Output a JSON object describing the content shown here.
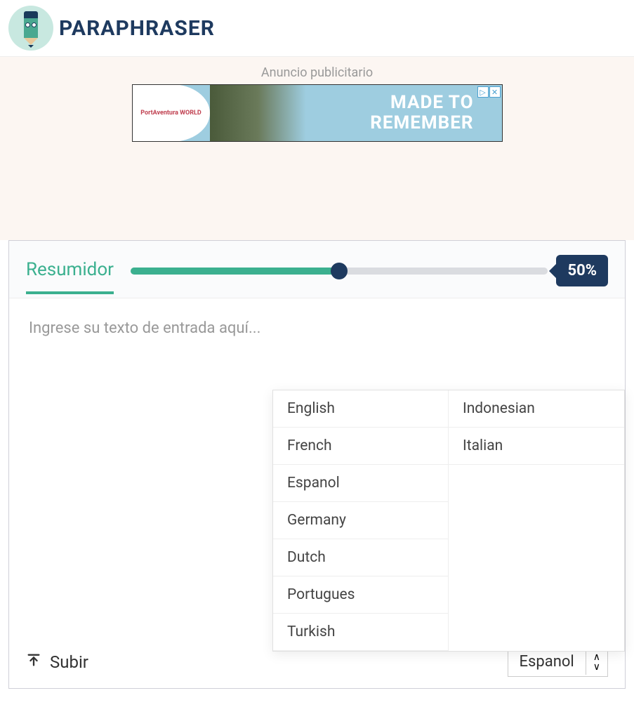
{
  "header": {
    "brand": "PARAPHRASER"
  },
  "ad": {
    "label": "Anuncio publicitario",
    "logo_text": "PortAventura WORLD",
    "tagline_1": "MADE TO",
    "tagline_2": "REMEMBER",
    "ad_mark": "▷",
    "close": "✕"
  },
  "panel": {
    "tab": "Resumidor",
    "percent": "50%",
    "slider_value": 50,
    "placeholder": "Ingrese su texto de entrada aquí..."
  },
  "dropdown": {
    "col1": [
      "English",
      "French",
      "Espanol",
      "Germany",
      "Dutch",
      "Portugues",
      "Turkish"
    ],
    "col2": [
      "Indonesian",
      "Italian"
    ]
  },
  "footer": {
    "upload": "Subir",
    "lang_selected": "Espanol"
  }
}
